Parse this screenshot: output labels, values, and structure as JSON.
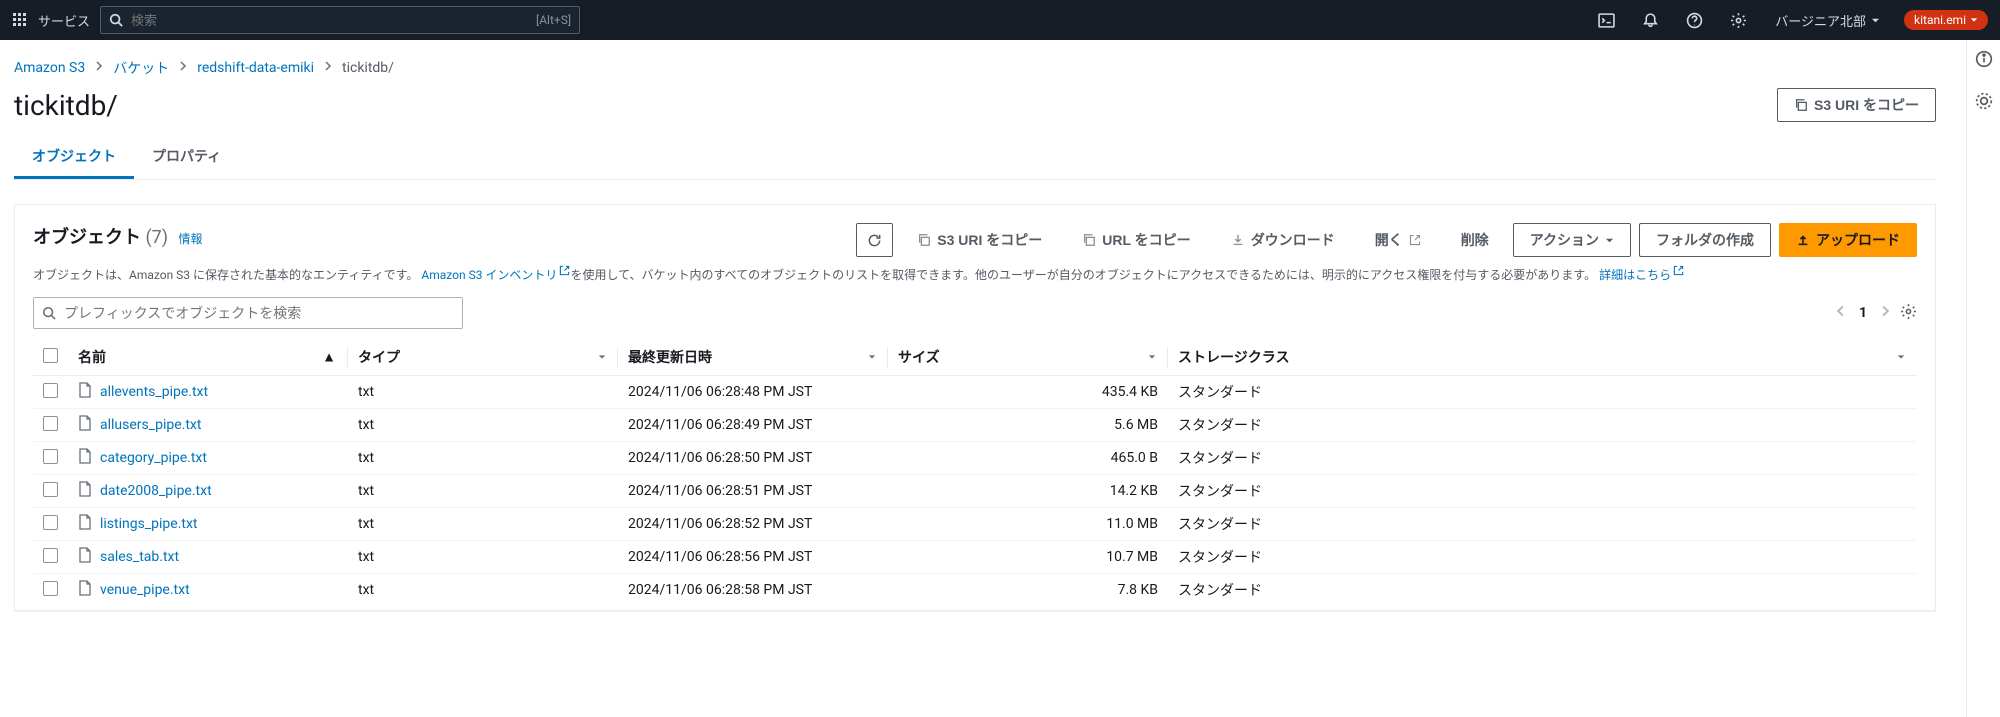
{
  "topnav": {
    "service_label": "サービス",
    "search_placeholder": "検索",
    "search_hint": "[Alt+S]",
    "region": "バージニア北部",
    "user": "kitani.emi"
  },
  "breadcrumb": {
    "root": "Amazon S3",
    "bucket_label": "バケット",
    "bucket_name": "redshift-data-emiki",
    "current": "tickitdb/"
  },
  "page": {
    "title": "tickitdb/",
    "copy_s3_uri": "S3 URI をコピー"
  },
  "tabs": {
    "objects": "オブジェクト",
    "properties": "プロパティ"
  },
  "panel": {
    "title": "オブジェクト",
    "count": "(7)",
    "info_label": "情報",
    "desc_pre": "オブジェクトは、Amazon S3 に保存された基本的なエンティティです。",
    "desc_link1": "Amazon S3 インベントリ",
    "desc_mid": "を使用して、バケット内のすべてのオブジェクトのリストを取得できます。他のユーザーが自分のオブジェクトにアクセスできるためには、明示的にアクセス権限を付与する必要があります。",
    "desc_link2": "詳細はこちら",
    "filter_placeholder": "プレフィックスでオブジェクトを検索",
    "page_number": "1",
    "actions": {
      "copy_s3_uri": "S3 URI をコピー",
      "copy_url": "URL をコピー",
      "download": "ダウンロード",
      "open": "開く",
      "delete": "削除",
      "actions_menu": "アクション",
      "create_folder": "フォルダの作成",
      "upload": "アップロード"
    }
  },
  "table": {
    "headers": {
      "name": "名前",
      "type": "タイプ",
      "last_modified": "最終更新日時",
      "size": "サイズ",
      "storage_class": "ストレージクラス"
    },
    "rows": [
      {
        "name": "allevents_pipe.txt",
        "type": "txt",
        "last_modified": "2024/11/06 06:28:48 PM JST",
        "size": "435.4 KB",
        "storage_class": "スタンダード"
      },
      {
        "name": "allusers_pipe.txt",
        "type": "txt",
        "last_modified": "2024/11/06 06:28:49 PM JST",
        "size": "5.6 MB",
        "storage_class": "スタンダード"
      },
      {
        "name": "category_pipe.txt",
        "type": "txt",
        "last_modified": "2024/11/06 06:28:50 PM JST",
        "size": "465.0 B",
        "storage_class": "スタンダード"
      },
      {
        "name": "date2008_pipe.txt",
        "type": "txt",
        "last_modified": "2024/11/06 06:28:51 PM JST",
        "size": "14.2 KB",
        "storage_class": "スタンダード"
      },
      {
        "name": "listings_pipe.txt",
        "type": "txt",
        "last_modified": "2024/11/06 06:28:52 PM JST",
        "size": "11.0 MB",
        "storage_class": "スタンダード"
      },
      {
        "name": "sales_tab.txt",
        "type": "txt",
        "last_modified": "2024/11/06 06:28:56 PM JST",
        "size": "10.7 MB",
        "storage_class": "スタンダード"
      },
      {
        "name": "venue_pipe.txt",
        "type": "txt",
        "last_modified": "2024/11/06 06:28:58 PM JST",
        "size": "7.8 KB",
        "storage_class": "スタンダード"
      }
    ]
  }
}
